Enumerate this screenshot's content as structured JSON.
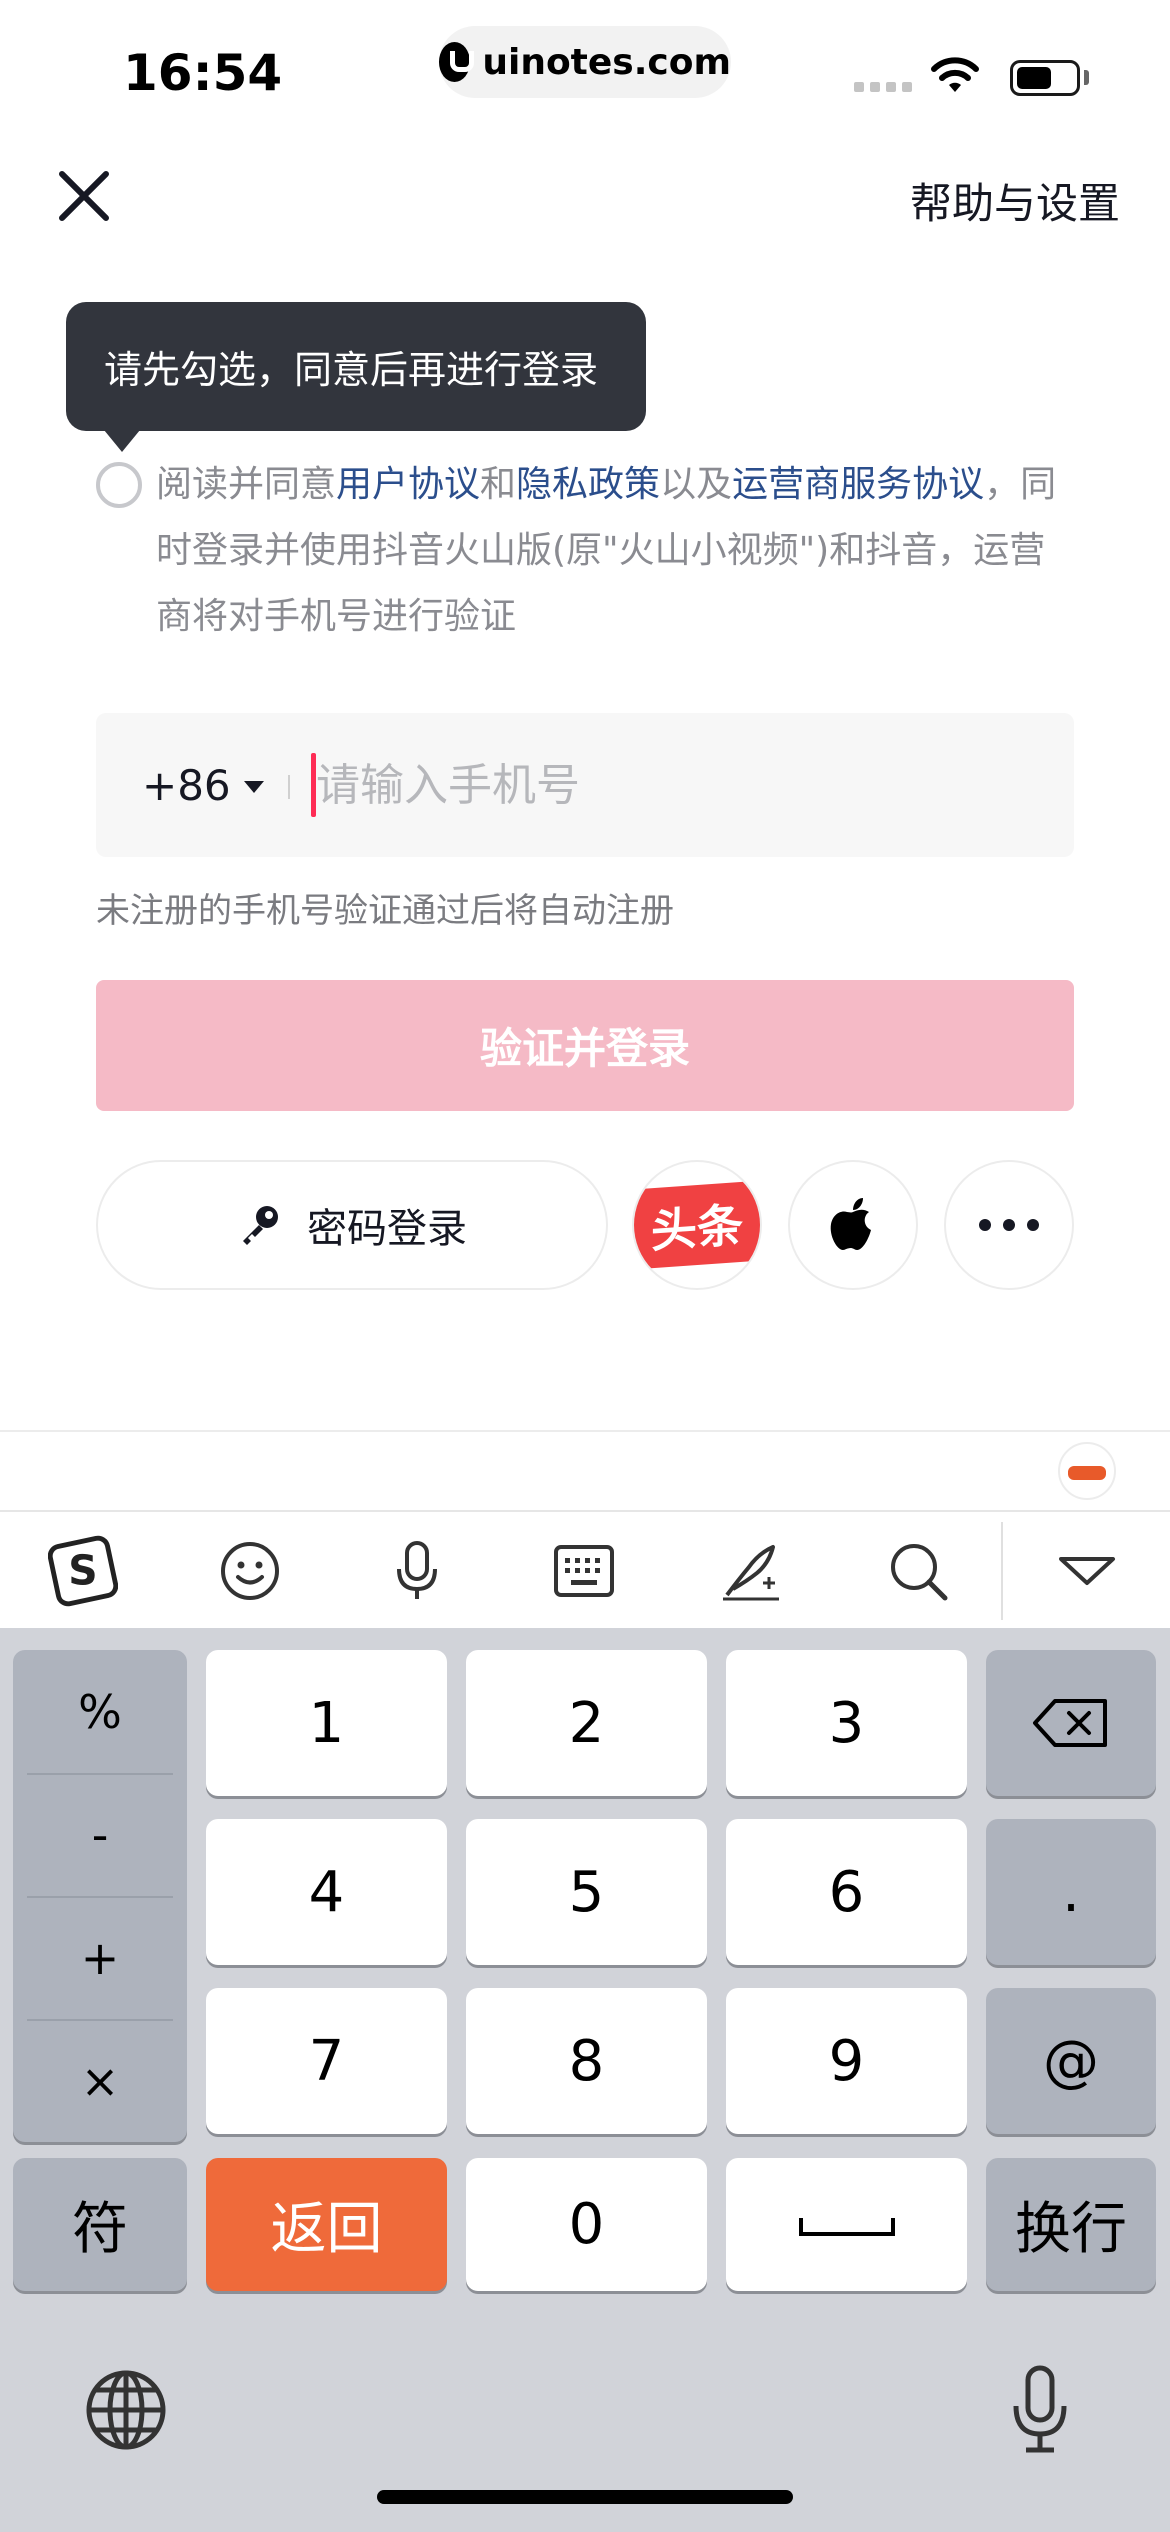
{
  "status_bar": {
    "time": "16:54",
    "url": "uinotes.com"
  },
  "header": {
    "help_label": "帮助与设置"
  },
  "tooltip": {
    "text": "请先勾选，同意后再进行登录"
  },
  "agreement": {
    "prefix": "阅读并同意",
    "user_agreement": "用户协议",
    "and": "和",
    "privacy_policy": "隐私政策",
    "also": "以及",
    "carrier_agreement": "运营商服务协议",
    "suffix": "，同时登录并使用抖音火山版(原\"火山小视频\")和抖音，运营商将对手机号进行验证"
  },
  "phone": {
    "country_code": "+86",
    "placeholder": "请输入手机号",
    "value": ""
  },
  "hint": "未注册的手机号验证通过后将自动注册",
  "login_button": "验证并登录",
  "alt_login": {
    "password_label": "密码登录",
    "toutiao_label": "头条"
  },
  "keyboard": {
    "toolbar_icons": [
      "sogou-logo-icon",
      "emoji-icon",
      "microphone-icon",
      "keyboard-icon",
      "handwriting-icon",
      "search-icon",
      "collapse-icon"
    ],
    "symbols": [
      "%",
      "-",
      "+",
      "×"
    ],
    "rows": [
      [
        "1",
        "2",
        "3"
      ],
      [
        "4",
        "5",
        "6"
      ],
      [
        "7",
        "8",
        "9"
      ]
    ],
    "dot": ".",
    "at": "@",
    "symbol_key": "符",
    "back_key": "返回",
    "zero": "0",
    "enter_key": "换行"
  },
  "colors": {
    "accent": "#fe2c55",
    "login_disabled": "#f5bac6",
    "link": "#2b4e8c",
    "keyboard_orange": "#ef6a3a",
    "tooltip_bg": "#32353d"
  }
}
